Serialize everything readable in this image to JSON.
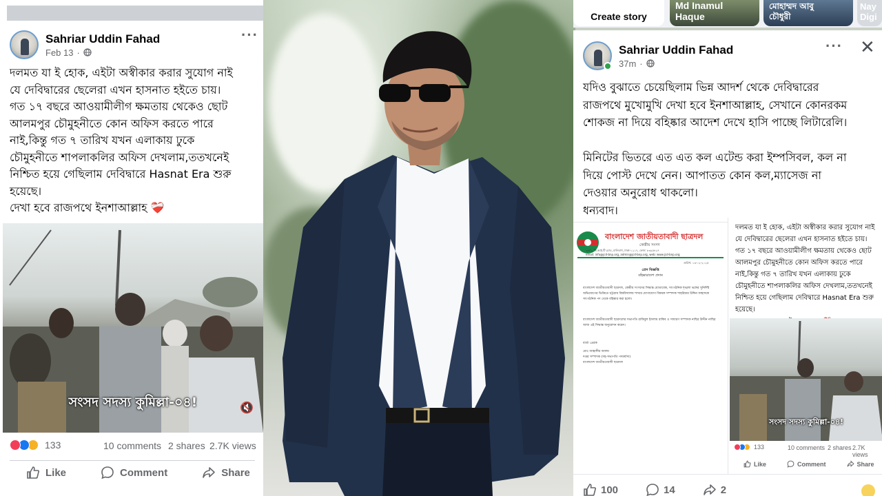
{
  "story_bar": {
    "create_story": "Create story",
    "story_1": "Md Inamul Haque",
    "story_2_line1": "মোহাম্মদ আবু",
    "story_2_line2": "চৌধুরী",
    "story_3_line1": "Nay",
    "story_3_line2": "Digi"
  },
  "left_post": {
    "author": "Sahriar Uddin Fahad",
    "date": "Feb 13",
    "body": "দলমত যা ই হোক, এইটা অস্বীকার করার সুযোগ নাই\nযে দেবিদ্বারের ছেলেরা এখন হাসনাত হইতে চায়।\nগত ১৭ বছরে আওয়ামীলীগ ক্ষমতায় থেকেও ছোট\nআলমপুর চৌমুহনীতে কোন অফিস করতে পারে\nনাই,কিন্তু গত ৭ তারিখ যখন এলাকায় ঢুকে\nচৌমুহনীতে শাপলাকলির অফিস দেখলাম,ততখনেই\nনিশ্চিত হয়ে গেছিলাম দেবিদ্বারে Hasnat Era শুরু\nহয়েছে।\nদেখা হবে রাজপথে ইনশাআল্লাহ ❤️‍🩹",
    "video_caption": "সংসদ সদস্য কুমিল্লা-০৪!",
    "reaction_count": "133",
    "comments": "10 comments",
    "shares": "2 shares",
    "views": "2.7K views",
    "like_label": "Like",
    "comment_label": "Comment",
    "share_label": "Share"
  },
  "right_post": {
    "author": "Sahriar Uddin Fahad",
    "time": "37m",
    "body": "যদিও বুঝাতে চেয়েছিলাম ভিন্ন আদর্শ থেকে দেবিদ্বারের\nরাজপথে মুখোমুখি দেখা হবে ইনশাআল্লাহ, সেখানে কোনরকম\nশোকজ না দিয়ে বহিষ্কার আদেশ দেখে হাসি পাচ্ছে লিটারেলি।\n\nমিনিটের ভিতরে এত এত কল এটেন্ড করা ইম্পসিবল, কল না\nদিয়ে পোস্ট দেখে নেন। আপাতত কোন কল,ম্যাসেজ না\nদেওয়ার অনুরোধ থাকলো।\nধন্যবাদ।",
    "letter": {
      "org_name": "বাংলাদেশ জাতীয়তাবাদী ছাত্রদল",
      "org_sub": "কেন্দ্রীয় সংসদ",
      "address": "৩৮/১, ডি.আই.টি রোড, মালিবাগ, ঢাকা-১২১৭, ফোন: ৮৩৯৫৪২৭",
      "email": "email: info@jcd-bnp.org, admin@jcd-bnp.org, web: www.jcd-bnp.org",
      "date": "তারিখ: ১৩-০২-২০২৫",
      "heading": "প্রেস বিজ্ঞপ্তি",
      "subheading": "বহিষ্কারাদেশ প্রদান",
      "para1": "বাংলাদেশ জাতীয়তাবাদী ছাত্রদল, কেন্দ্রীয় সংসদের সিদ্ধান্ত মোতাবেক, সাংগঠনিক শৃঙ্খলা ভঙ্গের সুনির্দিষ্ট অভিযোগের ভিত্তিতে চট্টগ্রাম বিশ্ববিদ্যালয় শাখার যোগাযোগ বিষয়ক সম্পাদক শাহরিয়ার উদ্দিন ফাহাদকে সাংগঠনিক পদ থেকে বহিষ্কার করা হলো।",
      "para2": "বাংলাদেশ জাতীয়তাবাদী ছাত্রদলের সভাপতি রাকিবুল ইসলাম রাকিব ও সাধারণ সম্পাদক নাছির উদ্দীন নাছির আজ এই সিদ্ধান্ত অনুমোদন করেন।",
      "sign1": "বার্তা প্রেরক",
      "sign2": "মোঃ জাহাঙ্গীর আলম",
      "sign3": "দপ্তর সম্পাদক (সহ-সভাপতি পদমর্যাদা)",
      "sign4": "বাংলাদেশ জাতীয়তাবাদী ছাত্রদল"
    },
    "embedded": {
      "body": "দলমত যা ই হোক, এইটা অস্বীকার করার সুযোগ নাই\nযে দেবিদ্বারের ছেলেরা এখন হাসনাত হইতে চায়।\nগত ১৭ বছরে আওয়ামীলীগ ক্ষমতায় থেকেও ছোট\nআলমপুর চৌমুহনীতে কোন অফিস করতে পারে\nনাই,কিন্তু গত ৭ তারিখ যখন এলাকায় ঢুকে\nচৌমুহনীতে শাপলাকলির অফিস দেখলাম,ততখনেই\nনিশ্চিত হয়ে গেছিলাম দেবিদ্বারে Hasnat Era শুরু\nহয়েছে।\nদেখা হবে রাজপথে ইনশাআল্লাহ ❤️‍🩹",
      "video_caption": "সংসদ সদস্য কুমিল্লা-০৪!",
      "reaction_count": "133",
      "comments": "10 comments",
      "shares": "2 shares",
      "views": "2.7K views",
      "like_label": "Like",
      "comment_label": "Comment",
      "share_label": "Share"
    },
    "bottom_like_count": "100",
    "bottom_comment_count": "14",
    "bottom_share_count": "2"
  },
  "colors": {
    "facebook_blue": "#1877f2",
    "meta_gray": "#65676b",
    "online_green": "#31a24c",
    "letter_green": "#1a8a4a",
    "letter_red": "#d32f2f"
  }
}
